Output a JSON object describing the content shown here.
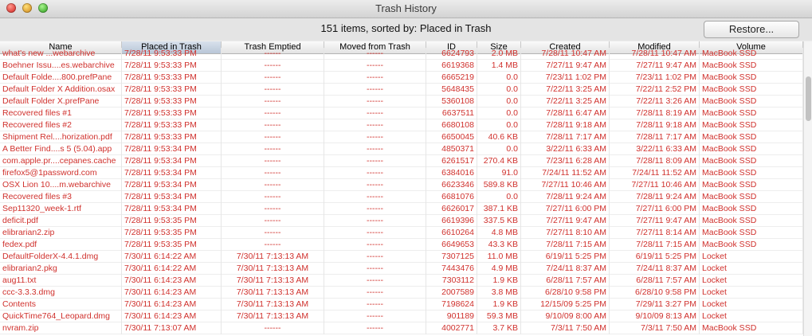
{
  "window": {
    "title": "Trash History"
  },
  "toolbar": {
    "status": "151 items, sorted by: Placed in Trash",
    "restore_label": "Restore..."
  },
  "columns": [
    "Name",
    "Placed in Trash",
    "Trash Emptied",
    "Moved from Trash",
    "ID",
    "Size",
    "Created",
    "Modified",
    "Volume"
  ],
  "partial_row": [
    "what's new ...webarchive",
    "7/28/11 9:53:33 PM",
    "------",
    "------",
    "6624793",
    "2.0 MB",
    "7/28/11 10:47 AM",
    "7/28/11 10:47 AM",
    "MacBook SSD"
  ],
  "rows": [
    [
      "Boehner Issu....es.webarchive",
      "7/28/11 9:53:33 PM",
      "------",
      "------",
      "6619368",
      "1.4 MB",
      "7/27/11 9:47 AM",
      "7/27/11 9:47 AM",
      "MacBook SSD"
    ],
    [
      "Default Folde....800.prefPane",
      "7/28/11 9:53:33 PM",
      "------",
      "------",
      "6665219",
      "0.0",
      "7/23/11 1:02 PM",
      "7/23/11 1:02 PM",
      "MacBook SSD"
    ],
    [
      "Default Folder X Addition.osax",
      "7/28/11 9:53:33 PM",
      "------",
      "------",
      "5648435",
      "0.0",
      "7/22/11 3:25 AM",
      "7/22/11 2:52 PM",
      "MacBook SSD"
    ],
    [
      "Default Folder X.prefPane",
      "7/28/11 9:53:33 PM",
      "------",
      "------",
      "5360108",
      "0.0",
      "7/22/11 3:25 AM",
      "7/22/11 3:26 AM",
      "MacBook SSD"
    ],
    [
      "Recovered files #1",
      "7/28/11 9:53:33 PM",
      "------",
      "------",
      "6637511",
      "0.0",
      "7/28/11 6:47 AM",
      "7/28/11 8:19 AM",
      "MacBook SSD"
    ],
    [
      "Recovered files #2",
      "7/28/11 9:53:33 PM",
      "------",
      "------",
      "6680108",
      "0.0",
      "7/28/11 9:18 AM",
      "7/28/11 9:18 AM",
      "MacBook SSD"
    ],
    [
      "Shipment Rel....horization.pdf",
      "7/28/11 9:53:33 PM",
      "------",
      "------",
      "6650045",
      "40.6 KB",
      "7/28/11 7:17 AM",
      "7/28/11 7:17 AM",
      "MacBook SSD"
    ],
    [
      "A Better Find....s 5 (5.04).app",
      "7/28/11 9:53:34 PM",
      "------",
      "------",
      "4850371",
      "0.0",
      "3/22/11 6:33 AM",
      "3/22/11 6:33 AM",
      "MacBook SSD"
    ],
    [
      "com.apple.pr....cepanes.cache",
      "7/28/11 9:53:34 PM",
      "------",
      "------",
      "6261517",
      "270.4 KB",
      "7/23/11 6:28 AM",
      "7/28/11 8:09 AM",
      "MacBook SSD"
    ],
    [
      "firefox5@1password.com",
      "7/28/11 9:53:34 PM",
      "------",
      "------",
      "6384016",
      "91.0",
      "7/24/11 11:52 AM",
      "7/24/11 11:52 AM",
      "MacBook SSD"
    ],
    [
      "OSX Lion 10....m.webarchive",
      "7/28/11 9:53:34 PM",
      "------",
      "------",
      "6623346",
      "589.8 KB",
      "7/27/11 10:46 AM",
      "7/27/11 10:46 AM",
      "MacBook SSD"
    ],
    [
      "Recovered files #3",
      "7/28/11 9:53:34 PM",
      "------",
      "------",
      "6681076",
      "0.0",
      "7/28/11 9:24 AM",
      "7/28/11 9:24 AM",
      "MacBook SSD"
    ],
    [
      "Sep11320_week-1.rtf",
      "7/28/11 9:53:34 PM",
      "------",
      "------",
      "6626017",
      "387.1 KB",
      "7/27/11 6:00 PM",
      "7/27/11 6:00 PM",
      "MacBook SSD"
    ],
    [
      "deficit.pdf",
      "7/28/11 9:53:35 PM",
      "------",
      "------",
      "6619396",
      "337.5 KB",
      "7/27/11 9:47 AM",
      "7/27/11 9:47 AM",
      "MacBook SSD"
    ],
    [
      "elibrarian2.zip",
      "7/28/11 9:53:35 PM",
      "------",
      "------",
      "6610264",
      "4.8 MB",
      "7/27/11 8:10 AM",
      "7/27/11 8:14 AM",
      "MacBook SSD"
    ],
    [
      "fedex.pdf",
      "7/28/11 9:53:35 PM",
      "------",
      "------",
      "6649653",
      "43.3 KB",
      "7/28/11 7:15 AM",
      "7/28/11 7:15 AM",
      "MacBook SSD"
    ],
    [
      "DefaultFolderX-4.4.1.dmg",
      "7/30/11 6:14:22 AM",
      "7/30/11 7:13:13 AM",
      "------",
      "7307125",
      "11.0 MB",
      "6/19/11 5:25 PM",
      "6/19/11 5:25 PM",
      "Locket"
    ],
    [
      "elibrarian2.pkg",
      "7/30/11 6:14:22 AM",
      "7/30/11 7:13:13 AM",
      "------",
      "7443476",
      "4.9 MB",
      "7/24/11 8:37 AM",
      "7/24/11 8:37 AM",
      "Locket"
    ],
    [
      "aug11.txt",
      "7/30/11 6:14:23 AM",
      "7/30/11 7:13:13 AM",
      "------",
      "7303112",
      "1.9 KB",
      "6/28/11 7:57 AM",
      "6/28/11 7:57 AM",
      "Locket"
    ],
    [
      "ccc-3.3.3.dmg",
      "7/30/11 6:14:23 AM",
      "7/30/11 7:13:13 AM",
      "------",
      "2007589",
      "3.8 MB",
      "6/28/10 9:58 PM",
      "6/28/10 9:58 PM",
      "Locket"
    ],
    [
      "Contents",
      "7/30/11 6:14:23 AM",
      "7/30/11 7:13:13 AM",
      "------",
      "7198624",
      "1.9 KB",
      "12/15/09 5:25 PM",
      "7/29/11 3:27 PM",
      "Locket"
    ],
    [
      "QuickTime764_Leopard.dmg",
      "7/30/11 6:14:23 AM",
      "7/30/11 7:13:13 AM",
      "------",
      "901189",
      "59.3 MB",
      "9/10/09 8:00 AM",
      "9/10/09 8:13 AM",
      "Locket"
    ],
    [
      "nvram.zip",
      "7/30/11 7:13:07 AM",
      "------",
      "------",
      "4002771",
      "3.7 KB",
      "7/3/11 7:50 AM",
      "7/3/11 7:50 AM",
      "MacBook SSD"
    ]
  ]
}
